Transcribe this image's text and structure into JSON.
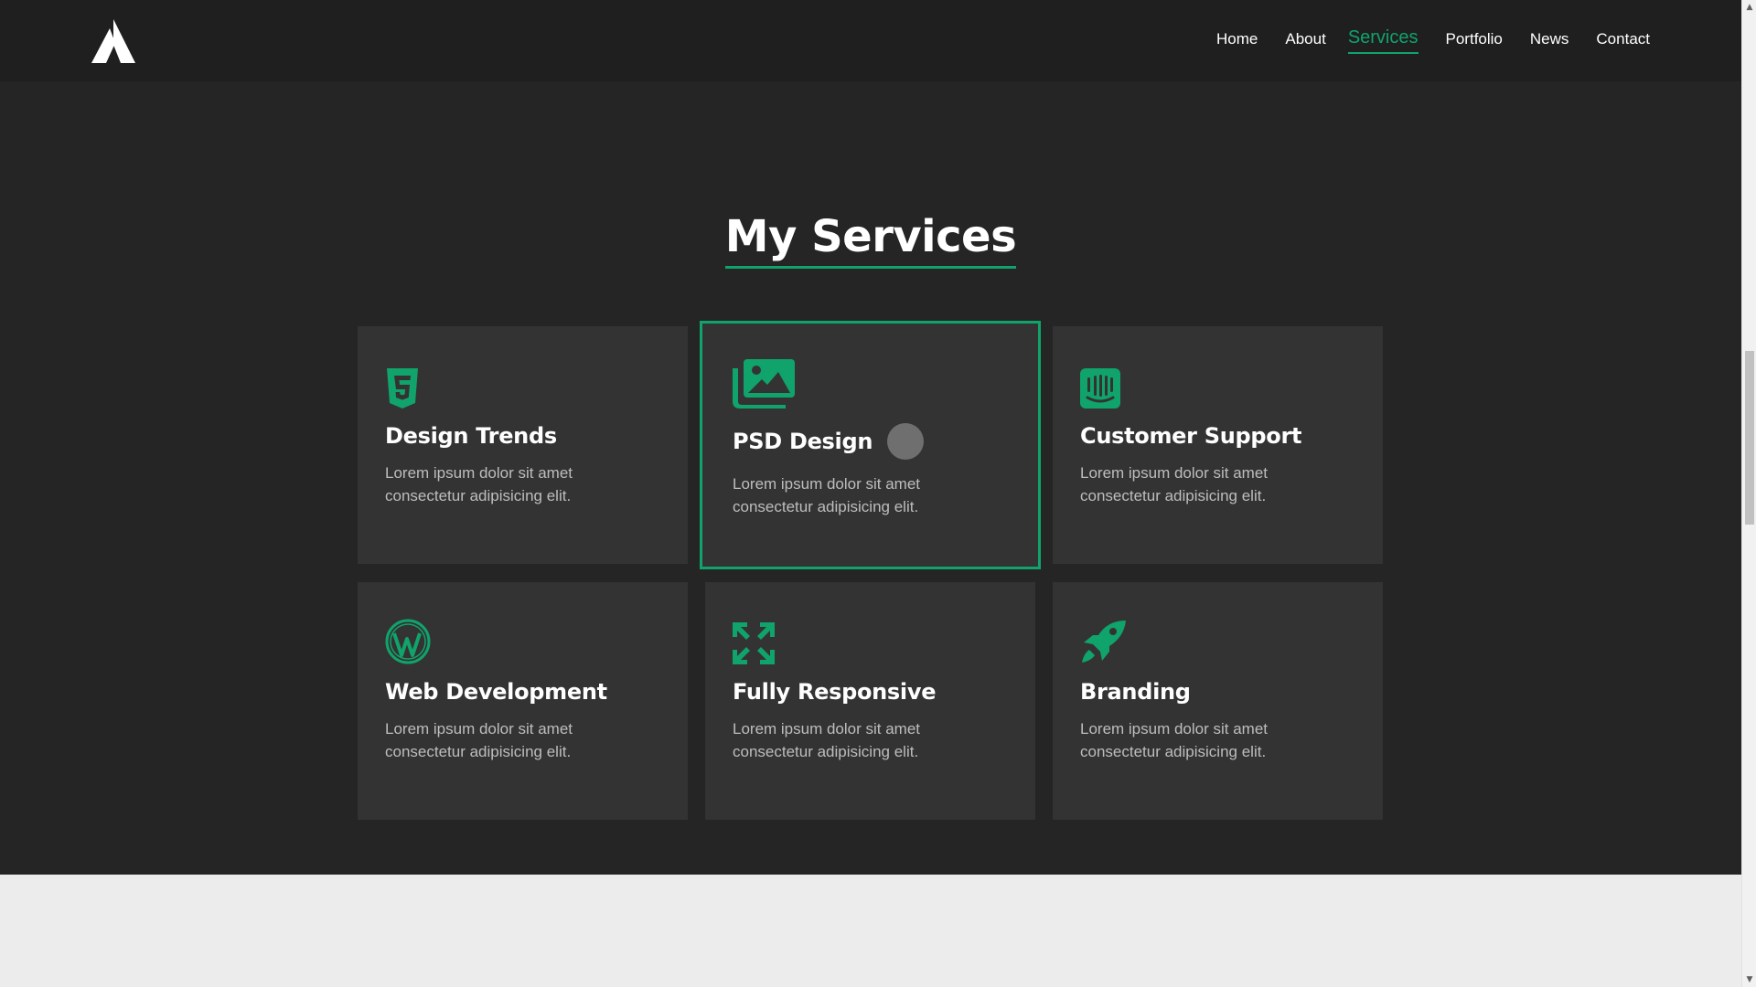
{
  "header": {
    "logo_icon": "triangle-logo-icon",
    "nav": [
      {
        "label": "Home",
        "active": false
      },
      {
        "label": "About",
        "active": false
      },
      {
        "label": "Services",
        "active": true
      },
      {
        "label": "Portfolio",
        "active": false
      },
      {
        "label": "News",
        "active": false
      },
      {
        "label": "Contact",
        "active": false
      }
    ]
  },
  "services": {
    "title": "My Services",
    "items": [
      {
        "icon": "html5-icon",
        "title": "Design Trends",
        "text": "Lorem ipsum dolor sit amet consectetur adipisicing elit."
      },
      {
        "icon": "images-icon",
        "title": "PSD Design",
        "text": "Lorem ipsum dolor sit amet consectetur adipisicing elit."
      },
      {
        "icon": "intercom-icon",
        "title": "Customer Support",
        "text": "Lorem ipsum dolor sit amet consectetur adipisicing elit."
      },
      {
        "icon": "wordpress-icon",
        "title": "Web Development",
        "text": "Lorem ipsum dolor sit amet consectetur adipisicing elit."
      },
      {
        "icon": "expand-arrows-icon",
        "title": "Fully Responsive",
        "text": "Lorem ipsum dolor sit amet consectetur adipisicing elit."
      },
      {
        "icon": "rocket-icon",
        "title": "Branding",
        "text": "Lorem ipsum dolor sit amet consectetur adipisicing elit."
      }
    ]
  },
  "colors": {
    "accent": "#10a36b",
    "header_bg": "#1f1f1f",
    "section_bg": "#252525",
    "card_bg": "#333333"
  }
}
